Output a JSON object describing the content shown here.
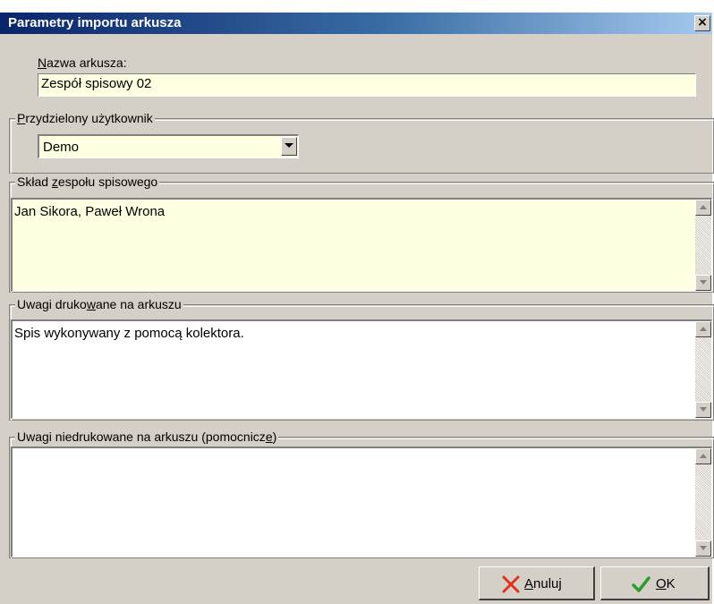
{
  "dialog": {
    "title": "Parametry importu arkusza",
    "close_symbol": "×"
  },
  "sheet_name": {
    "label_accel": "N",
    "label_rest": "azwa arkusza:",
    "value": "Zespół spisowy 02"
  },
  "assigned_user": {
    "label_accel": "P",
    "label_rest": "rzydzielony użytkownik",
    "value": "Demo"
  },
  "team": {
    "label_pre": "Skład ",
    "label_accel": "z",
    "label_post": "espołu spisowego",
    "value": "Jan Sikora, Paweł Wrona"
  },
  "printed_notes": {
    "label_pre": "Uwagi druko",
    "label_accel": "w",
    "label_post": "ane na arkuszu",
    "value": "Spis wykonywany z pomocą kolektora."
  },
  "nonprinted_notes": {
    "label_pre": "Uwagi niedrukowane na arkuszu (pomocnicz",
    "label_accel": "e",
    "label_post": ")",
    "value": ""
  },
  "buttons": {
    "cancel_accel": "A",
    "cancel_rest": "nuluj",
    "ok_accel": "O",
    "ok_rest": "K"
  },
  "colors": {
    "field_bg": "#ffffe1",
    "window_bg": "#d4d0c8",
    "titlebar_start": "#0a246a",
    "cancel_icon": "#e0301e",
    "ok_icon": "#2e9b2e"
  },
  "icons": {
    "close": "close-icon",
    "dropdown": "chevron-down-icon",
    "cancel": "x-cross-icon",
    "ok": "checkmark-icon"
  }
}
